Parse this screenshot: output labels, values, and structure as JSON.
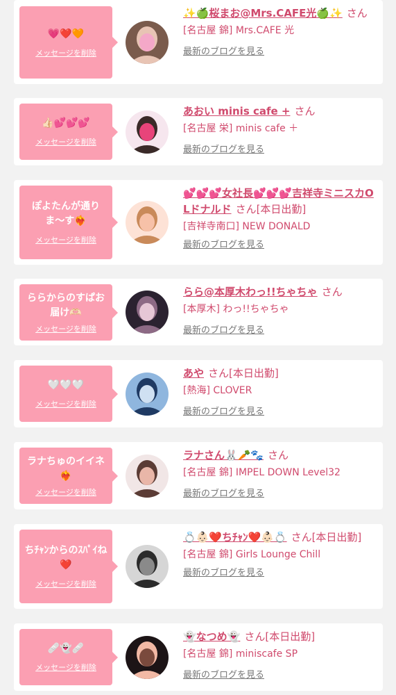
{
  "delete_label": "メッセージを削除",
  "blog_label": "最新のブログを見る",
  "honorific": "さん",
  "items": [
    {
      "message": "💗❤️🧡",
      "name": "✨🍏桜まお@Mrs.CAFE光🍏✨",
      "status": "",
      "shop": "[名古屋 錦] Mrs.CAFE 光",
      "avatar_colors": [
        "#7a5b4c",
        "#e8c4b4",
        "#f4a8c8"
      ]
    },
    {
      "message": "👍🏻💕💕💕",
      "name": "あおい minis cafe +",
      "status": "",
      "shop": "[名古屋 栄] minis cafe ＋",
      "avatar_colors": [
        "#f6e6ee",
        "#3a2a28",
        "#e8447a"
      ]
    },
    {
      "message": "ぽよたんが通りま〜す❤️‍🔥",
      "name": "💕💕💕女社長💕💕💕吉祥寺ミニスカOLドナルド",
      "status": "[本日出勤]",
      "shop": "[吉祥寺南口] NEW DONALD",
      "avatar_colors": [
        "#fde2d6",
        "#c98a5a",
        "#f7c1a8"
      ]
    },
    {
      "message": "ららからのすぱお届け🫶🏻",
      "name": "らら@本厚木わっ!!ちゃちゃ",
      "status": "",
      "shop": "[本厚木] わっ!!ちゃちゃ",
      "avatar_colors": [
        "#2b2230",
        "#8d6a85",
        "#e6c7d6"
      ]
    },
    {
      "message": "🤍🤍🤍",
      "name": "あや",
      "status": "[本日出勤]",
      "shop": "[熱海] CLOVER",
      "avatar_colors": [
        "#8fb6de",
        "#1f3a63",
        "#cfe0f2"
      ]
    },
    {
      "message": "ラナちゅのイイネ❤️‍🔥",
      "name": "ラナさん🐰🥕🐾",
      "status": "",
      "shop": "[名古屋 錦] IMPEL DOWN Level32",
      "avatar_colors": [
        "#f1e6e6",
        "#5b3c35",
        "#e9b6a8"
      ]
    },
    {
      "message": "ちﾁｬﾝからのｽﾊﾟｲね❤️",
      "name": "💍👶🏻❤️ちﾁｬﾝ❤️👶🏻💍",
      "status": "[本日出勤]",
      "shop": "[名古屋 錦] Girls Lounge Chill",
      "avatar_colors": [
        "#d6d6d6",
        "#2b2b2b",
        "#8a8a8a"
      ]
    },
    {
      "message": "🩹👻🩹",
      "name": "👻なつめ👻",
      "status": "[本日出勤]",
      "shop": "[名古屋 錦] miniscafe SP",
      "avatar_colors": [
        "#1c1416",
        "#f2b9a5",
        "#7a4a3d"
      ]
    }
  ]
}
